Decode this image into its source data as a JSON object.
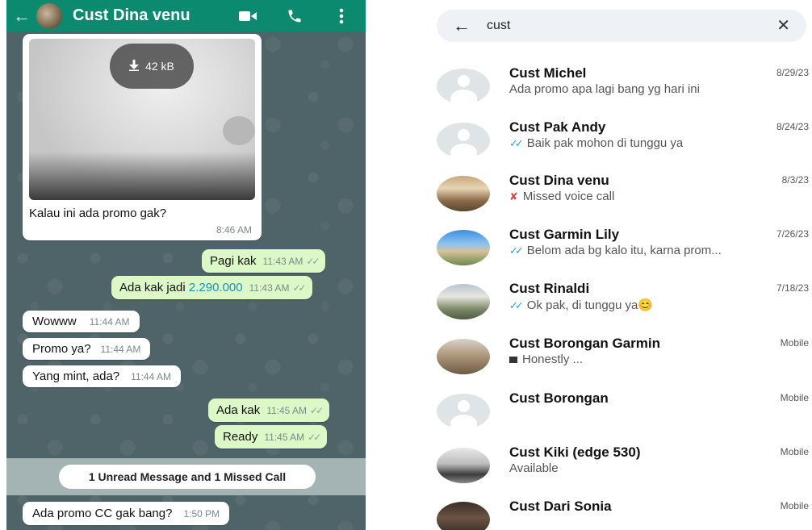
{
  "chat": {
    "header": {
      "title": "Cust Dina venu"
    },
    "media": {
      "size": "42 kB",
      "caption": "Kalau ini ada promo gak?",
      "time": "8:46 AM"
    },
    "messages": [
      {
        "text": "Pagi kak",
        "time": "11:43 AM",
        "ticks": "✓✓"
      },
      {
        "text": "Ada kak jadi ",
        "amount": "2.290.000",
        "time": "11:43 AM",
        "ticks": "✓✓"
      },
      {
        "text": "Wowww",
        "time": "11:44 AM"
      },
      {
        "text": "Promo ya?",
        "time": "11:44 AM"
      },
      {
        "text": "Yang mint, ada?",
        "time": "11:44 AM"
      },
      {
        "text": "Ada kak",
        "time": "11:45 AM",
        "ticks": "✓✓"
      },
      {
        "text": "Ready",
        "time": "11:45 AM",
        "ticks": "✓✓"
      },
      {
        "text": "Ada promo CC gak bang?",
        "time": "1:50 PM"
      }
    ],
    "unread_banner": "1 Unread Message and 1 Missed Call"
  },
  "search": {
    "query": "cust",
    "results": [
      {
        "name": "Cust Michel",
        "date": "8/29/23",
        "preview": "Ada promo apa lagi bang yg hari ini"
      },
      {
        "name": "Cust Pak Andy",
        "date": "8/24/23",
        "preview": "Baik pak mohon di tunggu ya"
      },
      {
        "name": "Cust Dina venu",
        "date": "8/3/23",
        "preview": "Missed voice call"
      },
      {
        "name": "Cust Garmin Lily",
        "date": "7/26/23",
        "preview": "Belom ada bg kalo itu, karna prom..."
      },
      {
        "name": "Cust Rinaldi",
        "date": "7/18/23",
        "preview": "Ok pak, di tunggu ya😊"
      },
      {
        "name": "Cust Borongan Garmin",
        "date": "Mobile",
        "preview": "Honestly ..."
      },
      {
        "name": "Cust Borongan",
        "date": "Mobile",
        "preview": ""
      },
      {
        "name": "Cust Kiki (edge 530)",
        "date": "Mobile",
        "preview": "Available"
      },
      {
        "name": "Cust Dari Sonia",
        "date": "Mobile",
        "preview": ""
      }
    ]
  },
  "colors": {
    "header_green": "#0b8a70",
    "outgoing_bubble": "#dcf8c6",
    "read_tick_blue": "#2aa2e0",
    "missed_call_red": "#e0443a"
  },
  "icons": [
    "back-arrow-icon",
    "video-call-icon",
    "phone-icon",
    "more-vert-icon",
    "download-icon",
    "clear-icon",
    "default-avatar-icon",
    "double-check-icon",
    "missed-call-icon"
  ]
}
